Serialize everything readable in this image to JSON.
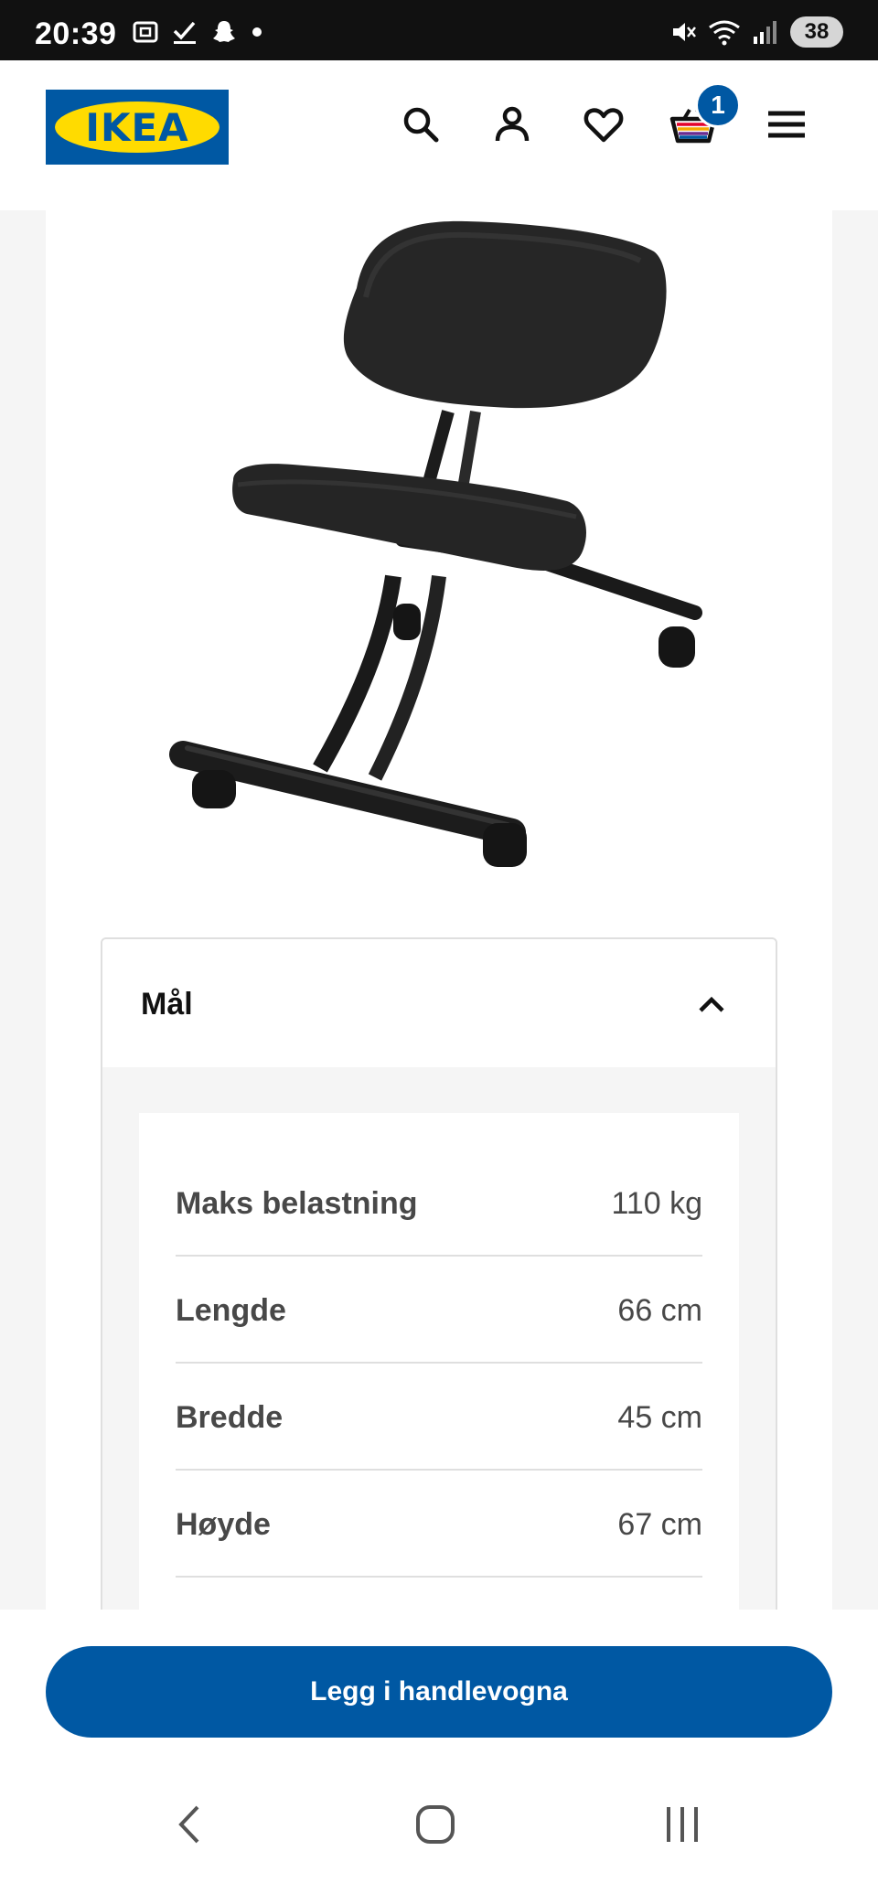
{
  "status_bar": {
    "time": "20:39",
    "battery": "38"
  },
  "header": {
    "logo_text": "IKEA",
    "cart_count": "1"
  },
  "accordion": {
    "title": "Mål",
    "rows": [
      {
        "label": "Maks belastning",
        "value": "110 kg"
      },
      {
        "label": "Lengde",
        "value": "66 cm"
      },
      {
        "label": "Bredde",
        "value": "45 cm"
      },
      {
        "label": "Høyde",
        "value": "67 cm"
      }
    ]
  },
  "actions": {
    "add_to_cart": "Legg i handlevogna"
  },
  "colors": {
    "brand_blue": "#0058a3",
    "brand_yellow": "#ffdb00"
  },
  "icons": [
    "search-icon",
    "account-icon",
    "heart-icon",
    "basket-icon",
    "menu-icon",
    "chevron-up-icon",
    "back-icon",
    "home-icon",
    "recents-icon"
  ]
}
